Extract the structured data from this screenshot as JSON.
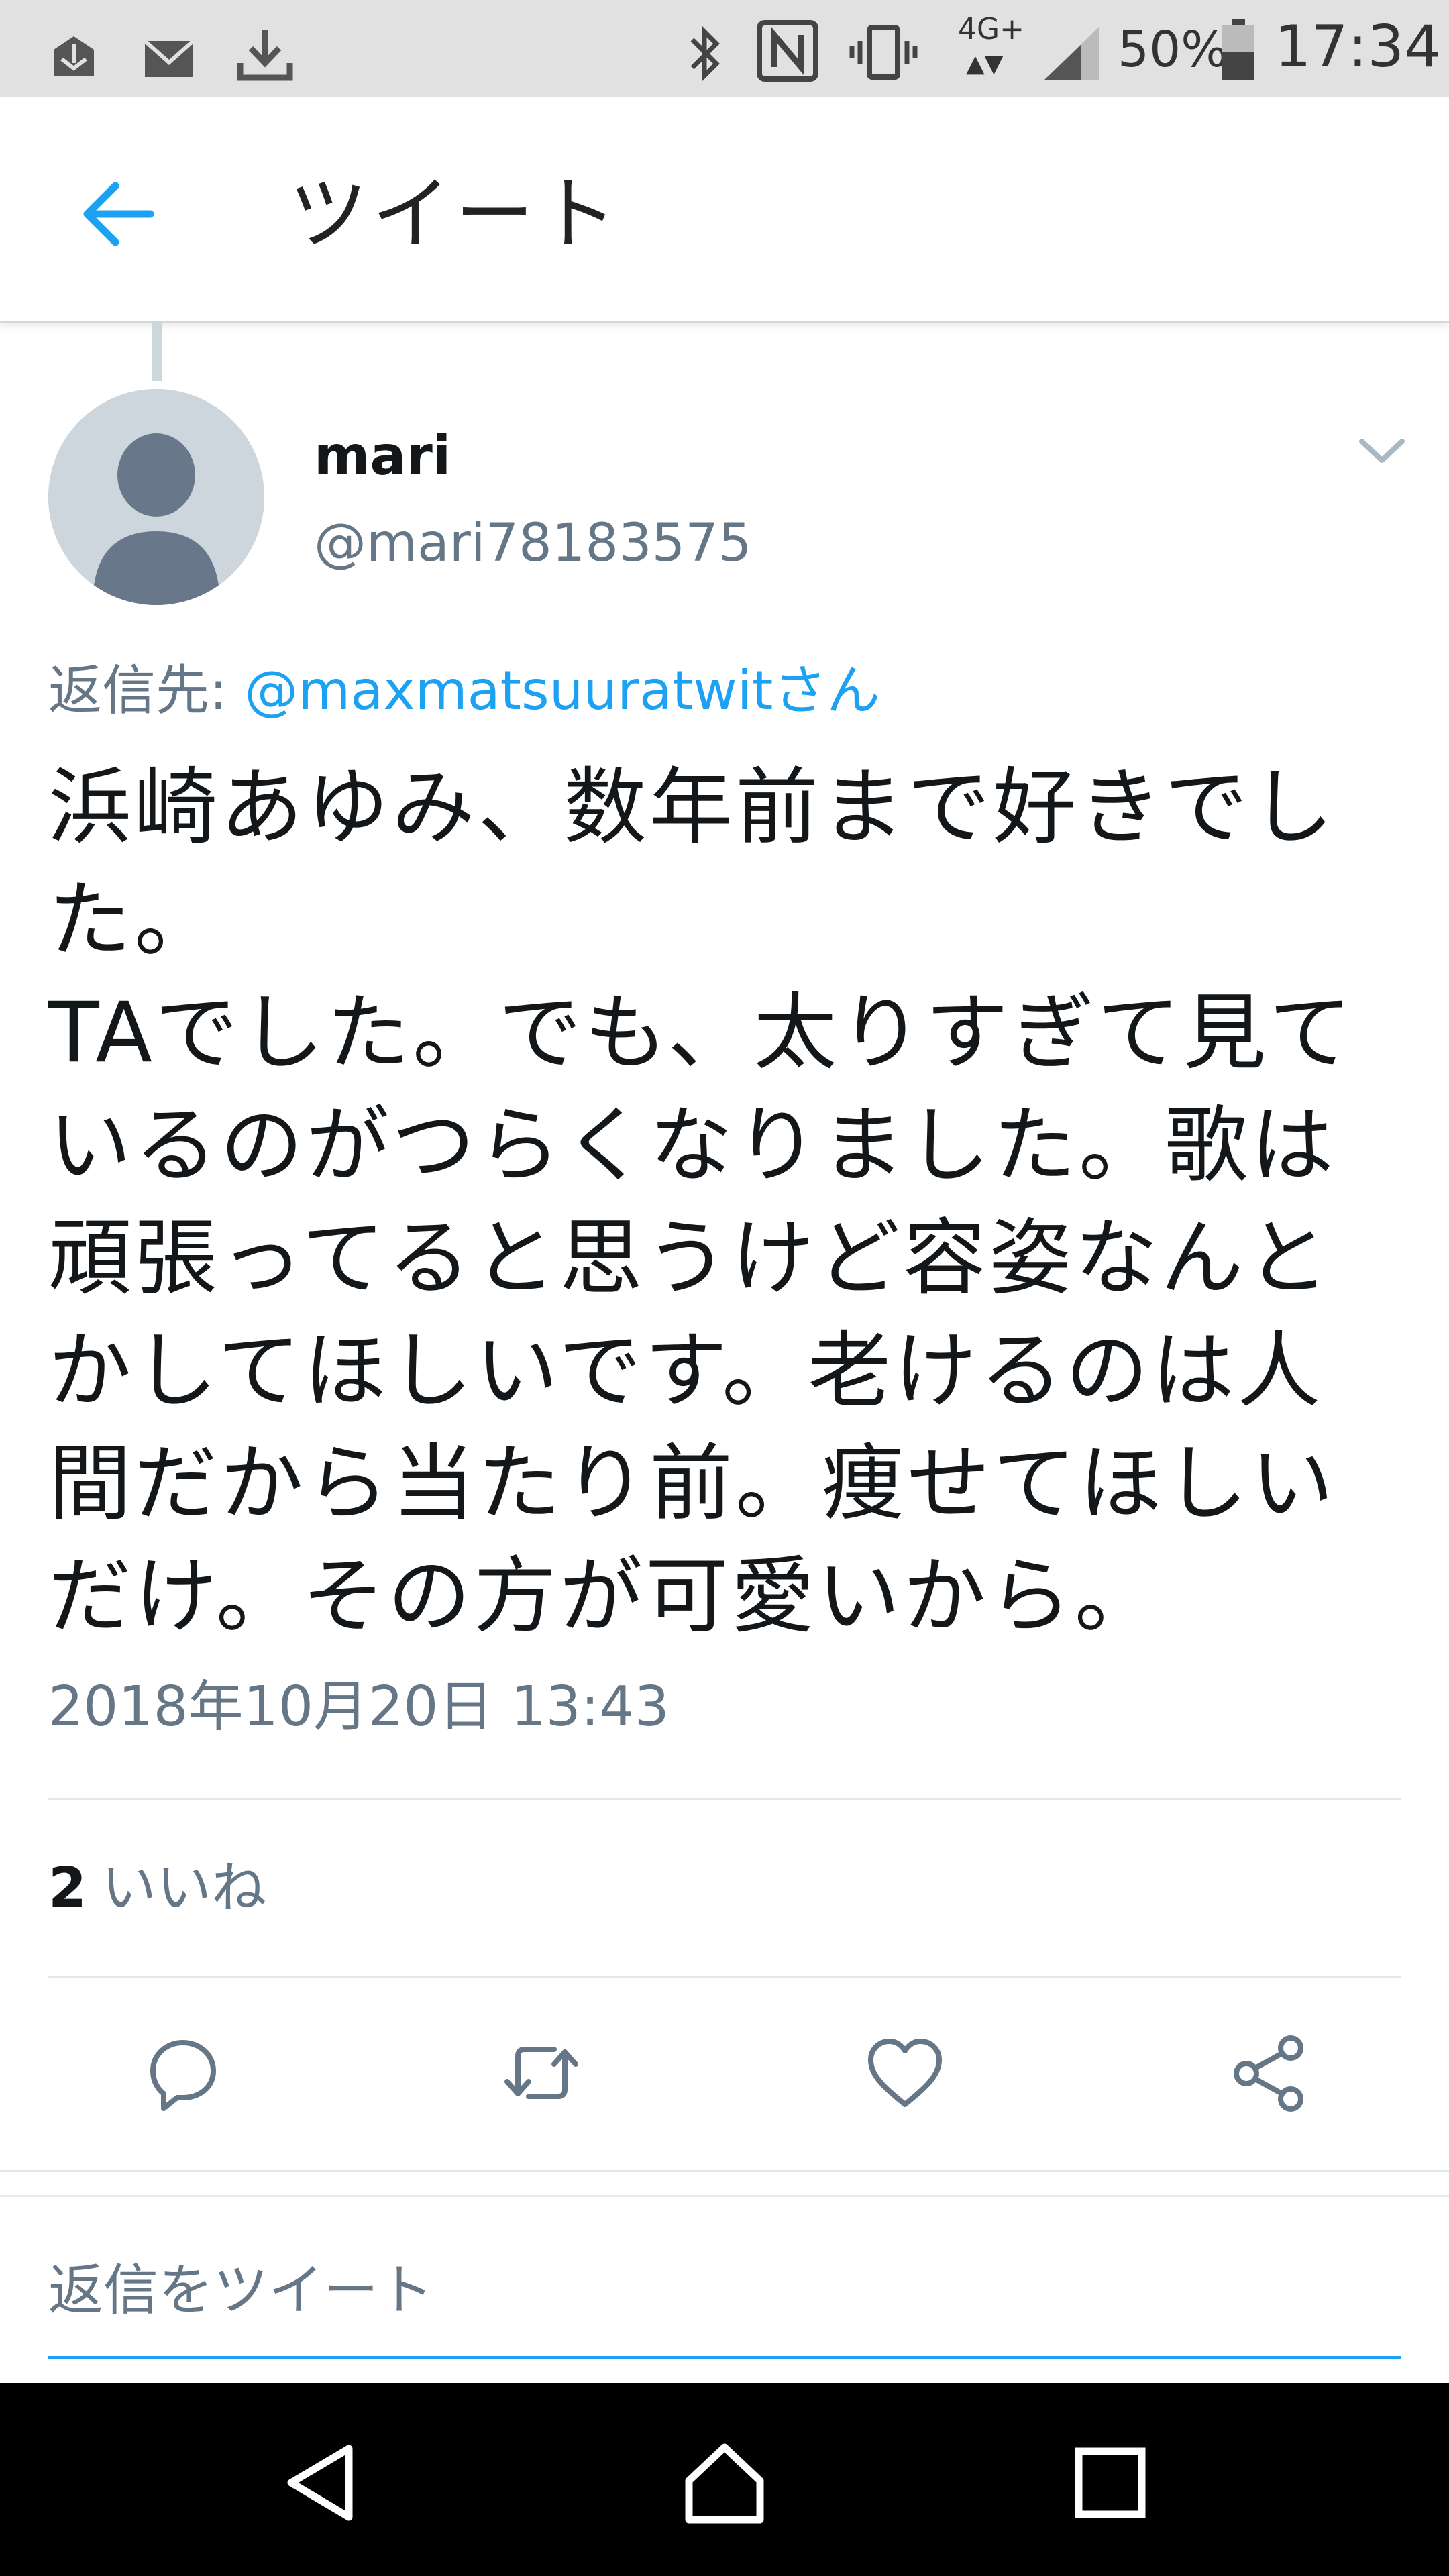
{
  "status_bar": {
    "time": "17:34",
    "battery": "50%",
    "network": "4G+"
  },
  "header": {
    "title": "ツイート"
  },
  "tweet": {
    "author_name": "mari",
    "author_handle": "@mari78183575",
    "reply_prefix": "返信先: ",
    "reply_mention": "@maxmatsuuratwitさん",
    "text": "浜崎あゆみ、数年前まで好きでした。\nTAでした。でも、太りすぎて見ているのがつらくなりました。歌は頑張ってると思うけど容姿なんとかしてほしいです。老けるのは人間だから当たり前。痩せてほしいだけ。その方が可愛いから。",
    "timestamp": "2018年10月20日 13:43",
    "likes_count": "2",
    "likes_label": "いいね"
  },
  "reply_box": {
    "placeholder": "返信をツイート"
  },
  "colors": {
    "accent": "#1da1f2",
    "secondary_text": "#657786",
    "status_bar_bg": "#e1e1e1",
    "nav_bar_bg": "#000000"
  },
  "icons": {
    "status_left": [
      "inbox-download-icon",
      "mail-icon",
      "download-icon"
    ],
    "status_right": [
      "bluetooth-icon",
      "nfc-icon",
      "vibrate-icon",
      "signal-icon",
      "battery-icon"
    ],
    "actions": [
      "reply-icon",
      "retweet-icon",
      "like-icon",
      "share-icon"
    ],
    "nav": [
      "nav-back-icon",
      "nav-home-icon",
      "nav-recents-icon"
    ]
  }
}
